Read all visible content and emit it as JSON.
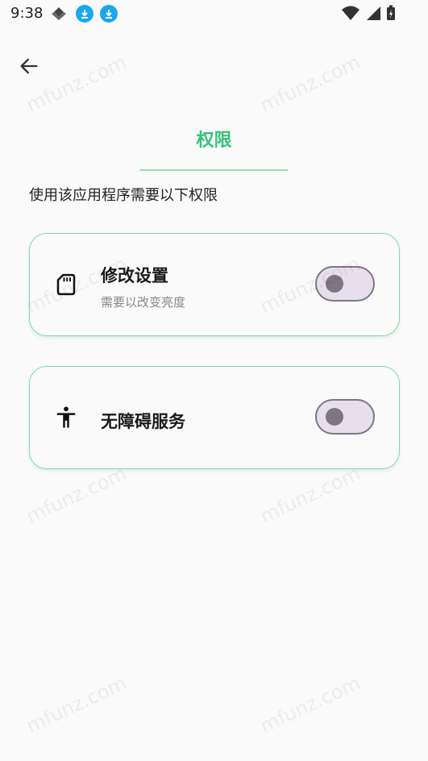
{
  "status_bar": {
    "time": "9:38"
  },
  "header": {
    "title": "权限"
  },
  "subtitle": "使用该应用程序需要以下权限",
  "permissions": [
    {
      "title": "修改设置",
      "description": "需要以改变亮度",
      "enabled": false,
      "icon": "sd-card-icon"
    },
    {
      "title": "无障碍服务",
      "description": "",
      "enabled": false,
      "icon": "accessibility-icon"
    }
  ],
  "watermark": "mfunz.com",
  "colors": {
    "accent": "#35c27a",
    "toggle_track": "#e7e0ec",
    "toggle_border": "#7c7685"
  }
}
